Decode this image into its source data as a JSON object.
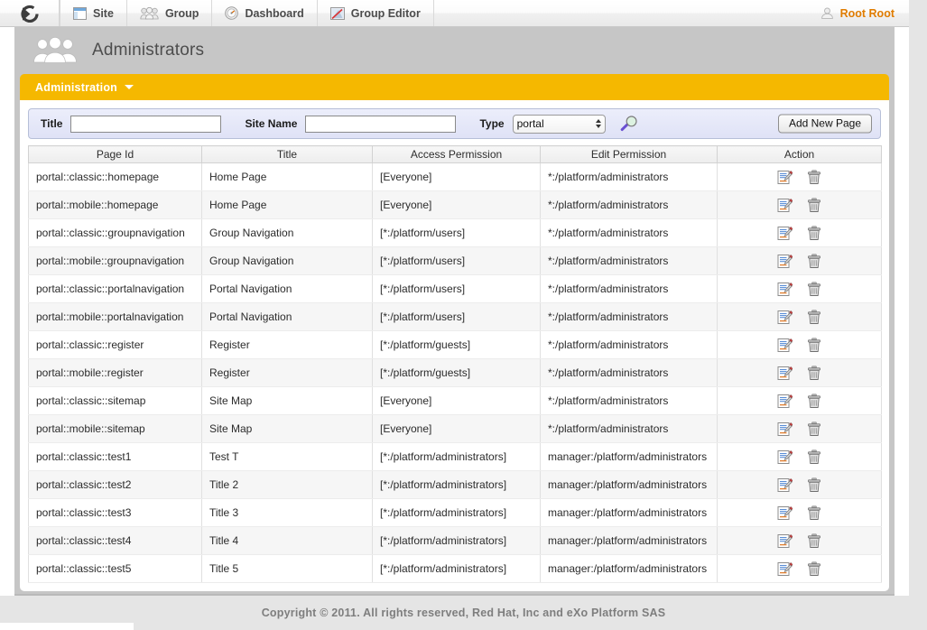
{
  "topbar": {
    "logo_icon": "exo-logo-icon",
    "items": [
      {
        "label": "Site",
        "icon": "site-icon"
      },
      {
        "label": "Group",
        "icon": "group-icon"
      },
      {
        "label": "Dashboard",
        "icon": "dashboard-icon"
      },
      {
        "label": "Group Editor",
        "icon": "group-editor-icon"
      }
    ],
    "user": {
      "label": "Root Root",
      "icon": "user-icon"
    }
  },
  "banner": {
    "icon": "administrators-group-icon",
    "title": "Administrators"
  },
  "adminbar": {
    "label": "Administration",
    "caret_icon": "chevron-down-icon"
  },
  "filter": {
    "title_label": "Title",
    "title_value": "",
    "title_placeholder": "",
    "sitename_label": "Site Name",
    "sitename_value": "",
    "sitename_placeholder": "",
    "type_label": "Type",
    "type_value": "portal",
    "type_options": [
      "portal"
    ],
    "search_icon": "search-magnifier-icon",
    "add_button": "Add New Page"
  },
  "table": {
    "columns": [
      "Page Id",
      "Title",
      "Access Permission",
      "Edit Permission",
      "Action"
    ],
    "edit_icon": "edit-page-icon",
    "delete_icon": "delete-trash-icon",
    "rows": [
      {
        "page_id": "portal::classic::homepage",
        "title": "Home Page",
        "access": "[Everyone]",
        "edit": "*:/platform/administrators"
      },
      {
        "page_id": "portal::mobile::homepage",
        "title": "Home Page",
        "access": "[Everyone]",
        "edit": "*:/platform/administrators"
      },
      {
        "page_id": "portal::classic::groupnavigation",
        "title": "Group Navigation",
        "access": "[*:/platform/users]",
        "edit": "*:/platform/administrators"
      },
      {
        "page_id": "portal::mobile::groupnavigation",
        "title": "Group Navigation",
        "access": "[*:/platform/users]",
        "edit": "*:/platform/administrators"
      },
      {
        "page_id": "portal::classic::portalnavigation",
        "title": "Portal Navigation",
        "access": "[*:/platform/users]",
        "edit": "*:/platform/administrators"
      },
      {
        "page_id": "portal::mobile::portalnavigation",
        "title": "Portal Navigation",
        "access": "[*:/platform/users]",
        "edit": "*:/platform/administrators"
      },
      {
        "page_id": "portal::classic::register",
        "title": "Register",
        "access": "[*:/platform/guests]",
        "edit": "*:/platform/administrators"
      },
      {
        "page_id": "portal::mobile::register",
        "title": "Register",
        "access": "[*:/platform/guests]",
        "edit": "*:/platform/administrators"
      },
      {
        "page_id": "portal::classic::sitemap",
        "title": "Site Map",
        "access": "[Everyone]",
        "edit": "*:/platform/administrators"
      },
      {
        "page_id": "portal::mobile::sitemap",
        "title": "Site Map",
        "access": "[Everyone]",
        "edit": "*:/platform/administrators"
      },
      {
        "page_id": "portal::classic::test1",
        "title": "Test T",
        "access": "[*:/platform/administrators]",
        "edit": "manager:/platform/administrators"
      },
      {
        "page_id": "portal::classic::test2",
        "title": "Title 2",
        "access": "[*:/platform/administrators]",
        "edit": "manager:/platform/administrators"
      },
      {
        "page_id": "portal::classic::test3",
        "title": "Title 3",
        "access": "[*:/platform/administrators]",
        "edit": "manager:/platform/administrators"
      },
      {
        "page_id": "portal::classic::test4",
        "title": "Title 4",
        "access": "[*:/platform/administrators]",
        "edit": "manager:/platform/administrators"
      },
      {
        "page_id": "portal::classic::test5",
        "title": "Title 5",
        "access": "[*:/platform/administrators]",
        "edit": "manager:/platform/administrators"
      }
    ]
  },
  "footer": {
    "text": "Copyright © 2011. All rights reserved, Red Hat, Inc and eXo Platform SAS"
  },
  "colors": {
    "accent_yellow": "#f5b800",
    "user_orange": "#e07c00",
    "page_gray": "#c6c6c6",
    "filter_blue": "#dfe2f6"
  }
}
